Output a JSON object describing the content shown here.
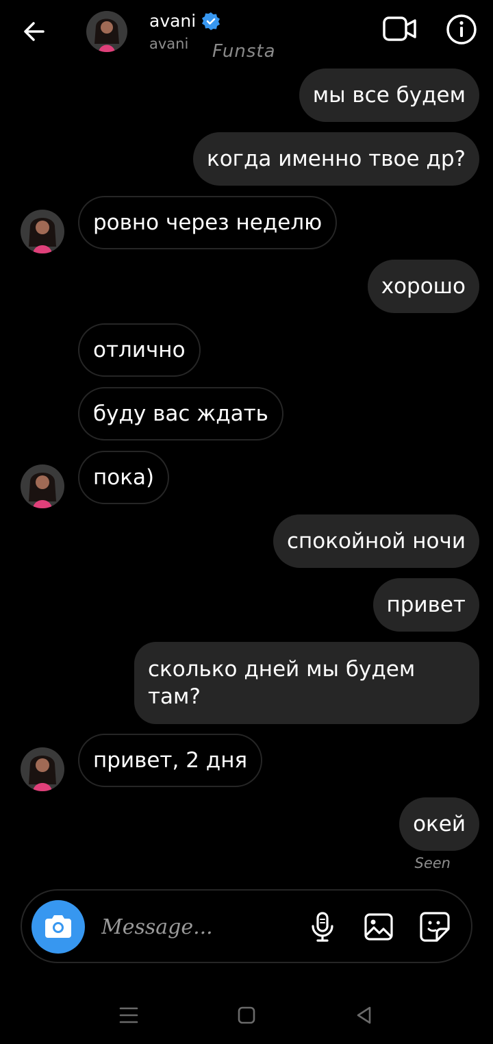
{
  "header": {
    "name": "avani",
    "username": "avani",
    "watermark": "Funsta",
    "verified_color": "#3797f0"
  },
  "messages": [
    {
      "dir": "sent",
      "text": "мы все будем"
    },
    {
      "dir": "sent",
      "text": "когда именно твое др?"
    },
    {
      "dir": "recv",
      "text": "ровно через неделю",
      "avatar": true
    },
    {
      "dir": "sent",
      "text": "хорошо"
    },
    {
      "dir": "recv",
      "text": "отлично"
    },
    {
      "dir": "recv",
      "text": "буду вас ждать"
    },
    {
      "dir": "recv",
      "text": "пока)",
      "avatar": true
    },
    {
      "dir": "sent",
      "text": "спокойной ночи"
    },
    {
      "dir": "sent",
      "text": "привет"
    },
    {
      "dir": "sent",
      "text": "сколько дней мы будем там?"
    },
    {
      "dir": "recv",
      "text": "привет, 2 дня",
      "avatar": true
    },
    {
      "dir": "sent",
      "text": "окей"
    }
  ],
  "seen_label": "Seen",
  "composer": {
    "placeholder": "Message..."
  },
  "colors": {
    "background": "#000000",
    "bubble_sent": "#262626",
    "camera_button": "#3797f0"
  },
  "icons": [
    "back-arrow-icon",
    "verified-badge-icon",
    "video-call-icon",
    "info-icon",
    "camera-icon",
    "microphone-icon",
    "gallery-icon",
    "sticker-icon",
    "menu-icon",
    "home-square-icon",
    "back-triangle-icon"
  ]
}
